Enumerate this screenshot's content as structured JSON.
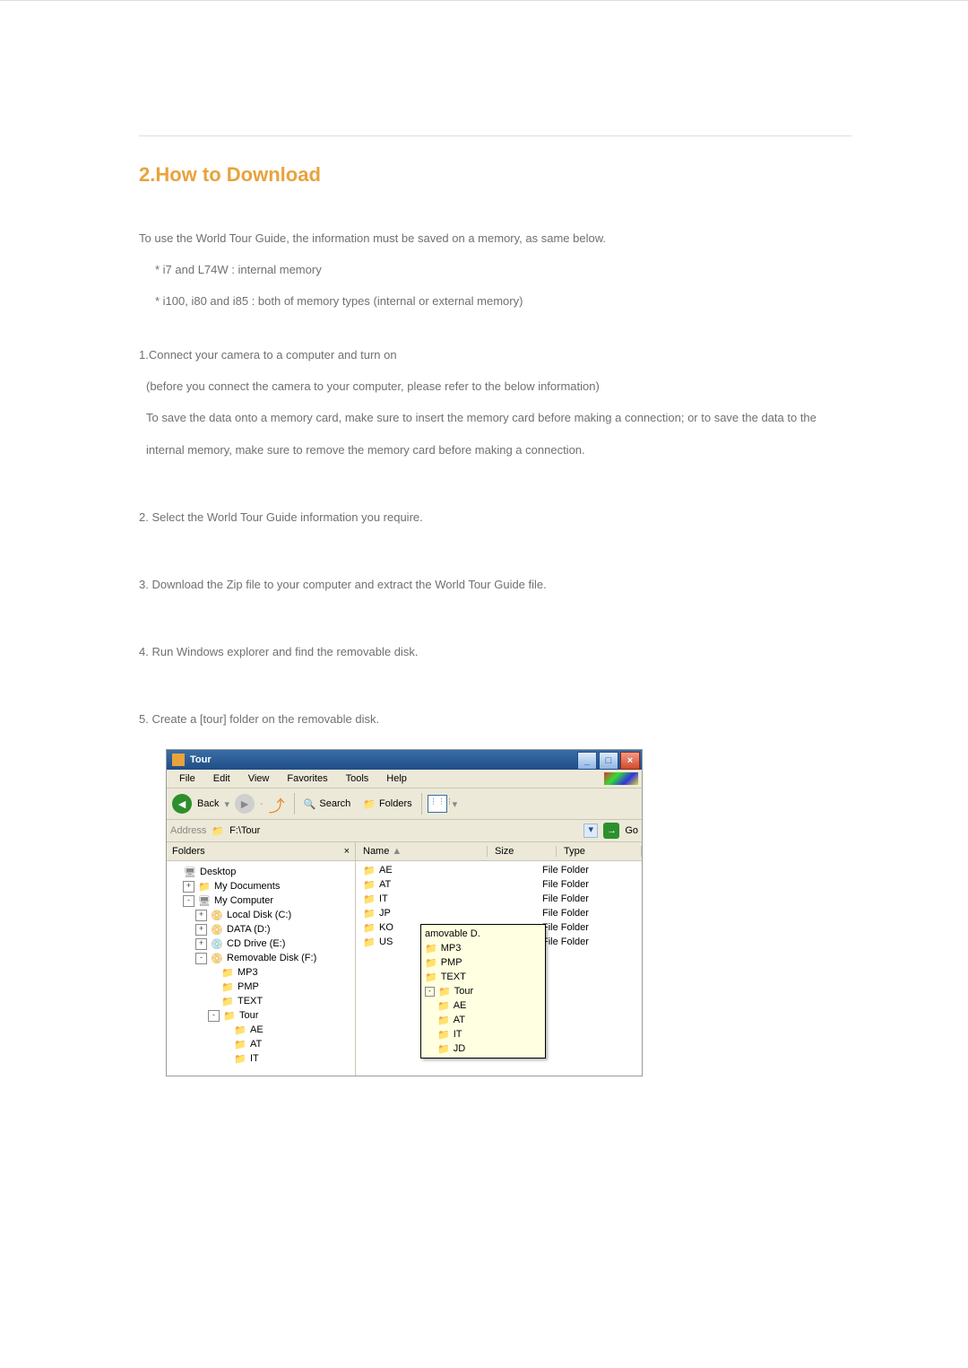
{
  "heading": "2.How to Download",
  "intro": "To use the World Tour Guide, the information must be saved on a memory, as same below.",
  "bullet1": "* i7 and   L74W : internal memory",
  "bullet2": "* i100, i80 and i85 : both of memory types (internal or external memory)",
  "step1a": "1.Connect your camera to a computer and turn on",
  "step1b": "(before you connect the camera to your computer, please refer to the below information)",
  "step1c": "To save the data onto a memory card, make sure to insert the memory card before making a connection; or to save the data to the internal memory, make sure to remove the memory card before making a connection.",
  "step2": "2. Select the World Tour Guide information you require.",
  "step3": "3. Download the Zip file to your computer and extract the World Tour Guide file.",
  "step4": "4. Run Windows explorer and find the removable disk.",
  "step5": "5. Create a [tour] folder on the removable disk.",
  "explorer": {
    "title": "Tour",
    "menus": [
      "File",
      "Edit",
      "View",
      "Favorites",
      "Tools",
      "Help"
    ],
    "toolbar": {
      "back": "Back",
      "search": "Search",
      "folders": "Folders"
    },
    "address": {
      "label": "Address",
      "path": "F:\\Tour",
      "go": "Go"
    },
    "panel_header": "Folders",
    "columns": {
      "name": "Name",
      "size": "Size",
      "type": "Type"
    },
    "tree": [
      {
        "level": 0,
        "toggle": "",
        "icon": "🖥",
        "label": "Desktop"
      },
      {
        "level": 1,
        "toggle": "+",
        "icon": "📁",
        "label": "My Documents"
      },
      {
        "level": 1,
        "toggle": "-",
        "icon": "🖥",
        "label": "My Computer"
      },
      {
        "level": 2,
        "toggle": "+",
        "icon": "📀",
        "label": "Local Disk (C:)"
      },
      {
        "level": 2,
        "toggle": "+",
        "icon": "📀",
        "label": "DATA (D:)"
      },
      {
        "level": 2,
        "toggle": "+",
        "icon": "💿",
        "label": "CD Drive (E:)"
      },
      {
        "level": 2,
        "toggle": "-",
        "icon": "📀",
        "label": "Removable Disk (F:)"
      },
      {
        "level": 3,
        "toggle": "",
        "icon": "📁",
        "label": "MP3"
      },
      {
        "level": 3,
        "toggle": "",
        "icon": "📁",
        "label": "PMP"
      },
      {
        "level": 3,
        "toggle": "",
        "icon": "📁",
        "label": "TEXT"
      },
      {
        "level": 3,
        "toggle": "-",
        "icon": "📁",
        "label": "Tour"
      },
      {
        "level": 4,
        "toggle": "",
        "icon": "📁",
        "label": "AE"
      },
      {
        "level": 4,
        "toggle": "",
        "icon": "📁",
        "label": "AT"
      },
      {
        "level": 4,
        "toggle": "",
        "icon": "📁",
        "label": "IT"
      }
    ],
    "rows": [
      {
        "name": "AE",
        "type": "File Folder"
      },
      {
        "name": "AT",
        "type": "File Folder"
      },
      {
        "name": "IT",
        "type": "File Folder"
      },
      {
        "name": "JP",
        "type": "File Folder"
      },
      {
        "name": "KO",
        "type": "File Folder"
      },
      {
        "name": "US",
        "type": "File Folder"
      }
    ],
    "tooltip": {
      "header": "amovable D.",
      "items": [
        "MP3",
        "PMP",
        "TEXT",
        "Tour",
        "AE",
        "AT",
        "IT",
        "JD"
      ]
    }
  }
}
